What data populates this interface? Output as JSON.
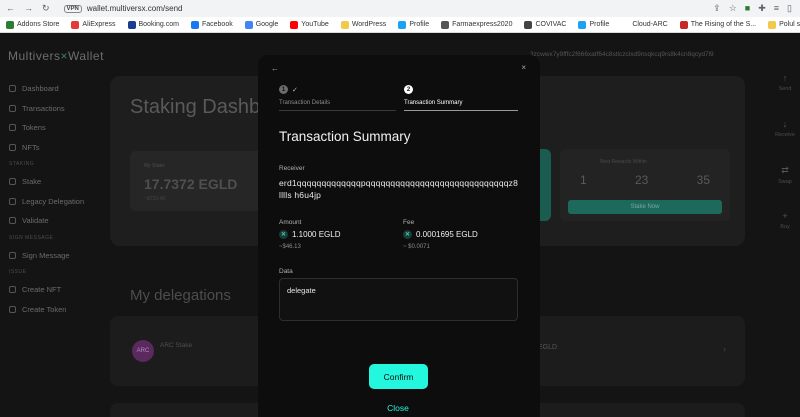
{
  "browser": {
    "url": "wallet.multiversx.com/send",
    "bookmarks": [
      {
        "label": "Addons Store",
        "color": "#2e7d32"
      },
      {
        "label": "AliExpress",
        "color": "#e53935"
      },
      {
        "label": "Booking.com",
        "color": "#1a3d8f"
      },
      {
        "label": "Facebook",
        "color": "#1877f2"
      },
      {
        "label": "Google",
        "color": "#4285f4"
      },
      {
        "label": "YouTube",
        "color": "#ff0000"
      },
      {
        "label": "WordPress",
        "color": "#f2c94c"
      },
      {
        "label": "Profile",
        "color": "#1da1f2"
      },
      {
        "label": "Farmaexpress2020",
        "color": "#555555"
      },
      {
        "label": "COVIVAC",
        "color": "#444444"
      },
      {
        "label": "Profile",
        "color": "#1da1f2"
      },
      {
        "label": "Cloud-ARC",
        "color": "#ffffff"
      },
      {
        "label": "The Rising of the S...",
        "color": "#c62828"
      },
      {
        "label": "Polul sud si polul n...",
        "color": "#f2c94c"
      }
    ]
  },
  "app": {
    "logo": "MultiversX",
    "logo_main": "Multivers",
    "logo_x": "×",
    "logo_tail": "Wallet",
    "address_fragment": "3zcwwx7y9fffc2f666xatf64c8stlczclxd9nsqkcq9rs8k4cn8qcyd7l9",
    "sidebar": {
      "items": [
        {
          "label": "Dashboard"
        },
        {
          "label": "Transactions"
        },
        {
          "label": "Tokens"
        },
        {
          "label": "NFTs"
        }
      ],
      "staking_section": "STAKING",
      "staking_items": [
        {
          "label": "Stake"
        },
        {
          "label": "Legacy Delegation"
        },
        {
          "label": "Validate"
        }
      ],
      "sign_section": "SIGN MESSAGE",
      "sign_items": [
        {
          "label": "Sign Message"
        }
      ],
      "issue_section": "ISSUE",
      "issue_items": [
        {
          "label": "Create NFT"
        },
        {
          "label": "Create Token"
        }
      ]
    },
    "dashboard": {
      "title": "Staking Dashb",
      "balance_label": "My Stake",
      "balance": "17.7372 EGLD",
      "balance_usd": "~$733.48",
      "reward_label": "Next Rewards Within",
      "countdown": [
        "1",
        "23",
        "35"
      ],
      "stake_button": "Stake Now",
      "delegations_title": "My delegations",
      "delegation_name": "ARC Stake",
      "delegation_avatar": "ARC",
      "delegation_egld": "EGLD"
    },
    "rightbar": [
      {
        "label": "Send",
        "icon": "↑"
      },
      {
        "label": "Receive",
        "icon": "↓"
      },
      {
        "label": "Swap",
        "icon": "⇄"
      },
      {
        "label": "Buy",
        "icon": "+"
      }
    ]
  },
  "modal": {
    "steps": [
      {
        "number": "1",
        "label": "Transaction Details",
        "done": true
      },
      {
        "number": "2",
        "label": "Transaction Summary",
        "active": true
      }
    ],
    "title": "Transaction Summary",
    "receiver_label": "Receiver",
    "receiver": "erd1qqqqqqqqqqqqqpqqqqqqqqqqqqqqqqqqqqqqqqqqqqqz8lllls h6u4jp",
    "amount_label": "Amount",
    "amount": "1.1000 EGLD",
    "amount_usd": "~$46.13",
    "fee_label": "Fee",
    "fee": "0.0001695 EGLD",
    "fee_usd": "~ $0.0071",
    "data_label": "Data",
    "data_value": "delegate",
    "confirm_label": "Confirm",
    "close_label": "Close",
    "token_icon": "x-token-icon",
    "accent": "#23f7dd"
  }
}
